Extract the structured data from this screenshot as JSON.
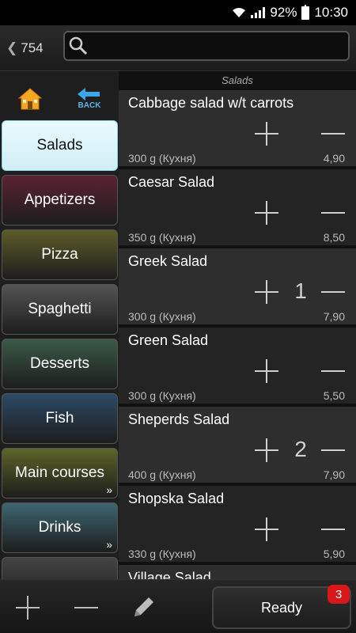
{
  "status_bar": {
    "battery": "92%",
    "time": "10:30"
  },
  "top_bar": {
    "back_count": "754",
    "search_placeholder": ""
  },
  "nav": {
    "back_label": "BACK"
  },
  "categories": [
    {
      "label": "Salads",
      "selected": true,
      "color": "#cfeef4"
    },
    {
      "label": "Appetizers",
      "color": "#5a2233"
    },
    {
      "label": "Pizza",
      "color": "#5d5c2a"
    },
    {
      "label": "Spaghetti",
      "color": "#545454"
    },
    {
      "label": "Desserts",
      "color": "#3b5a47"
    },
    {
      "label": "Fish",
      "color": "#2c4a66"
    },
    {
      "label": "Main courses",
      "more": "»",
      "color": "#5d6428"
    },
    {
      "label": "Drinks",
      "more": "»",
      "color": "#3e6670"
    },
    {
      "label": "",
      "color": "#444"
    }
  ],
  "section_title": "Salads",
  "items": [
    {
      "name": "Cabbage salad w/t carrots",
      "weight": "300 g (Кухня)",
      "price": "4,90",
      "qty": "",
      "shade": "#2e2e2e"
    },
    {
      "name": "Caesar Salad",
      "weight": "350 g (Кухня)",
      "price": "8,50",
      "qty": "",
      "shade": "#242424"
    },
    {
      "name": "Greek Salad",
      "weight": "300 g (Кухня)",
      "price": "7,90",
      "qty": "1",
      "shade": "#2e2e2e"
    },
    {
      "name": "Green Salad",
      "weight": "300 g (Кухня)",
      "price": "5,50",
      "qty": "",
      "shade": "#242424"
    },
    {
      "name": "Sheperds Salad",
      "weight": "400 g (Кухня)",
      "price": "7,90",
      "qty": "2",
      "shade": "#2e2e2e"
    },
    {
      "name": "Shopska Salad",
      "weight": "330 g (Кухня)",
      "price": "5,90",
      "qty": "",
      "shade": "#242424"
    },
    {
      "name": "Village Salad",
      "weight": "",
      "price": "",
      "qty": "",
      "shade": "#2e2e2e"
    }
  ],
  "bottom_bar": {
    "ready_label": "Ready",
    "badge_count": "3"
  }
}
